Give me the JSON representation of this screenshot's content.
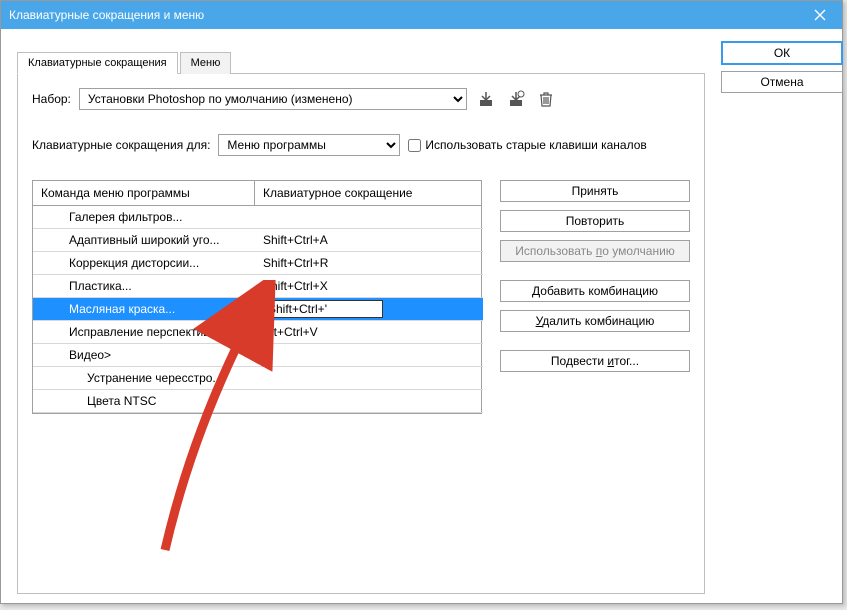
{
  "window": {
    "title": "Клавиатурные сокращения и меню"
  },
  "tabs": {
    "active": "Клавиатурные сокращения",
    "other": "Меню"
  },
  "set_row": {
    "label": "Набор:",
    "value": "Установки Photoshop по умолчанию (изменено)"
  },
  "for_row": {
    "label": "Клавиатурные сокращения для:",
    "value": "Меню программы"
  },
  "legacy_checkbox": {
    "label": "Использовать старые клавиши каналов"
  },
  "columns": {
    "c1": "Команда меню программы",
    "c2": "Клавиатурное сокращение"
  },
  "rows": [
    {
      "name": "Галерея фильтров...",
      "shortcut": "",
      "indent": 1
    },
    {
      "name": "Адаптивный широкий уго...",
      "shortcut": "Shift+Ctrl+A",
      "indent": 1
    },
    {
      "name": "Коррекция дисторсии...",
      "shortcut": "Shift+Ctrl+R",
      "indent": 1
    },
    {
      "name": "Пластика...",
      "shortcut": "Shift+Ctrl+X",
      "indent": 1
    },
    {
      "name": "Масляная краска...",
      "shortcut": "Shift+Ctrl+'",
      "indent": 1,
      "selected": true
    },
    {
      "name": "Исправление перспектив...",
      "shortcut": "Alt+Ctrl+V",
      "indent": 1
    },
    {
      "name": "Видео>",
      "shortcut": "",
      "indent": 1
    },
    {
      "name": "Устранение чересстро...",
      "shortcut": "",
      "indent": 2
    },
    {
      "name": "Цвета NTSC",
      "shortcut": "",
      "indent": 2
    }
  ],
  "action_buttons": {
    "accept": "Принять",
    "repeat": "Повторить",
    "use_default": "Использовать по умолчанию",
    "add": "Добавить комбинацию",
    "remove": "Удалить комбинацию",
    "summarize": "Подвести итог..."
  },
  "side_buttons": {
    "ok": "ОК",
    "cancel": "Отмена"
  }
}
